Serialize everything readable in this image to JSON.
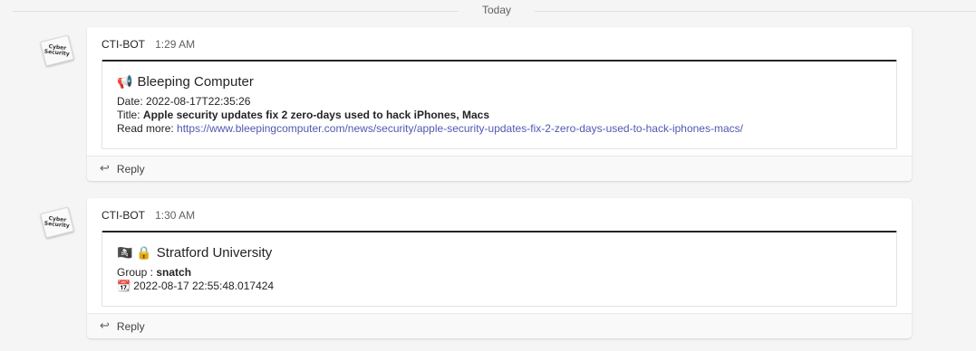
{
  "divider": {
    "label": "Today"
  },
  "messages": [
    {
      "avatar_text": "Cyber\nSecurity",
      "author": "CTI-BOT",
      "time": "1:29 AM",
      "card": {
        "title_icon": "megaphone-icon",
        "title_glyph": "📢",
        "title": "Bleeping Computer",
        "date_label": "Date:",
        "date_value": "2022-08-17T22:35:26",
        "title_label": "Title:",
        "title_value": "Apple security updates fix 2 zero-days used to hack iPhones, Macs",
        "readmore_label": "Read more:",
        "readmore_url": "https://www.bleepingcomputer.com/news/security/apple-security-updates-fix-2-zero-days-used-to-hack-iphones-macs/"
      },
      "reply_label": "Reply"
    },
    {
      "avatar_text": "Cyber\nSecurity",
      "author": "CTI-BOT",
      "time": "1:30 AM",
      "card": {
        "title_icons": [
          "pirate-flag-icon",
          "lock-icon"
        ],
        "title_glyph": "🏴‍☠️ 🔒",
        "title": "Stratford University",
        "group_label": "Group :",
        "group_value": "snatch",
        "timestamp_icon": "calendar-icon",
        "timestamp_glyph": "📆",
        "timestamp": "2022-08-17 22:55:48.017424"
      },
      "reply_label": "Reply"
    }
  ]
}
